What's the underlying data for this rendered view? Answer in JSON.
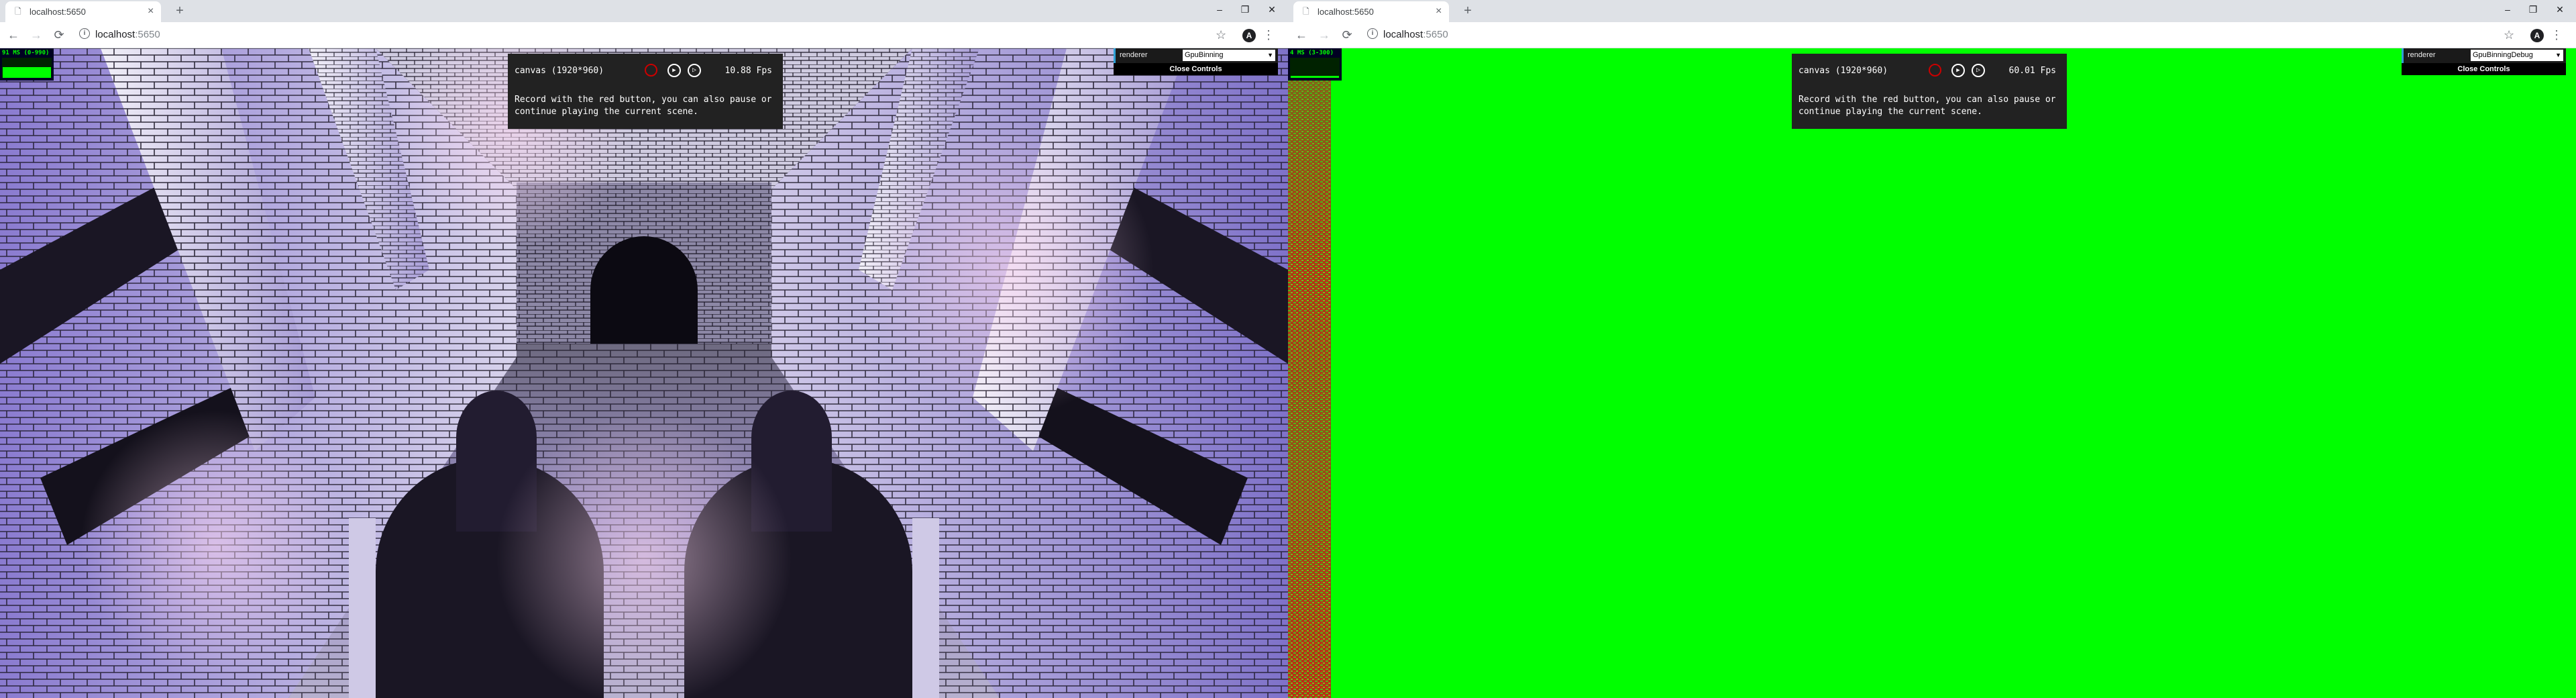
{
  "left": {
    "tab": {
      "title": "localhost:5650",
      "close": "×",
      "new_tab": "+"
    },
    "window_controls": {
      "minimize": "–",
      "maximize": "❐",
      "close": "✕"
    },
    "toolbar": {
      "back": "←",
      "forward": "→",
      "reload": "⟳",
      "url_host": "localhost",
      "url_port": ":5650",
      "info": "i",
      "star": "☆",
      "avatar": "A",
      "menu": "⋮"
    },
    "stats": {
      "text": "91 MS (0-990)",
      "level": 0.55
    },
    "panel": {
      "canvas_label": "canvas (1920*960)",
      "play": "▶",
      "forward": "▷",
      "fps": "10.88 Fps",
      "help": "Record with the red button, you can also pause or continue playing the current scene."
    },
    "gui": {
      "label": "renderer",
      "value": "GpuBinning",
      "caret": "▼",
      "close": "Close Controls"
    }
  },
  "right": {
    "tab": {
      "title": "localhost:5650",
      "close": "×",
      "new_tab": "+"
    },
    "window_controls": {
      "minimize": "–",
      "maximize": "❐",
      "close": "✕"
    },
    "toolbar": {
      "back": "←",
      "forward": "→",
      "reload": "⟳",
      "url_host": "localhost",
      "url_port": ":5650",
      "info": "i",
      "star": "☆",
      "avatar": "A",
      "menu": "⋮"
    },
    "stats": {
      "text": "4 MS (3-300)",
      "level": 0.1
    },
    "panel": {
      "canvas_label": "canvas (1920*960)",
      "play": "▶",
      "forward": "▷",
      "fps": "60.01 Fps",
      "help": "Record with the red button, you can also pause or continue playing the current scene."
    },
    "gui": {
      "label": "renderer",
      "value": "GpuBinningDebug",
      "caret": "▼",
      "close": "Close Controls"
    }
  },
  "colors": {
    "debug_green": "#00ff00",
    "debug_red": "#c81e14",
    "stone_light": "#d9d4ea",
    "stone_purple": "#8f7cc8",
    "stone_dark": "#2a2438"
  }
}
